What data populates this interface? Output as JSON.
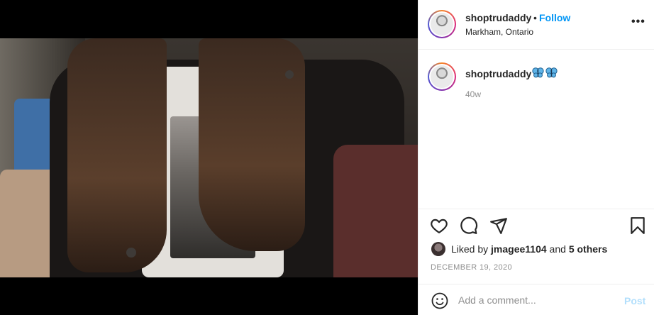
{
  "post": {
    "author": {
      "username": "shoptrudaddy",
      "follow_label": "Follow",
      "separator": "•",
      "location": "Markham, Ontario"
    },
    "menu_icon": "more-horizontal-icon",
    "caption": {
      "username": "shoptrudaddy",
      "emoji": [
        "butterfly-emoji",
        "butterfly-emoji"
      ],
      "age": "40w"
    },
    "actions": {
      "icons": [
        "heart-icon",
        "comment-icon",
        "share-icon",
        "bookmark-icon"
      ]
    },
    "likes": {
      "prefix": "Liked by ",
      "liker": "jmagee1104",
      "middle": " and ",
      "others": "5 others"
    },
    "date": "DECEMBER 19, 2020",
    "comment": {
      "placeholder": "Add a comment...",
      "post_label": "Post",
      "emoji_icon": "smiley-icon"
    },
    "colors": {
      "accent": "#0095f6",
      "post_disabled": "#b2dffc",
      "muted": "#8e8e8e",
      "text": "#262626"
    }
  }
}
